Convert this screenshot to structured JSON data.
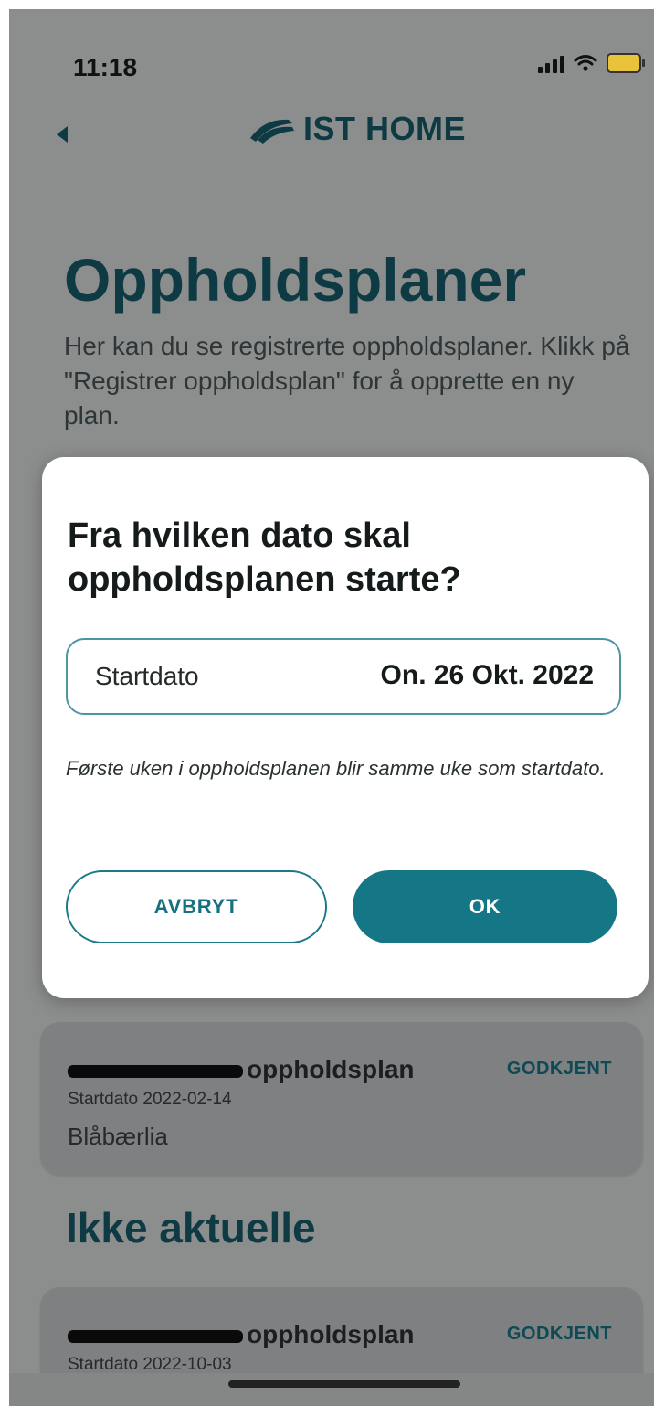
{
  "status_bar": {
    "time": "11:18",
    "signal_icon": "signal-icon",
    "wifi_icon": "wifi-icon",
    "battery_icon": "battery-charging-icon"
  },
  "header": {
    "back_icon": "back-arrow-icon",
    "logo_text": "IST HOME",
    "logo_icon": "ist-logo-icon"
  },
  "page": {
    "title": "Oppholdsplaner",
    "intro": "Her kan du se registrerte oppholdsplaner. Klikk på \"Registrer oppholdsplan\" for å opprette en ny plan."
  },
  "cards": [
    {
      "title_suffix": "oppholdsplan",
      "status": "GODKJENT",
      "date": "Startdato 2022-02-14",
      "place": "Blåbærlia"
    },
    {
      "title_suffix": "oppholdsplan",
      "status": "GODKJENT",
      "date": "Startdato 2022-10-03"
    }
  ],
  "sections": {
    "inactive": "Ikke aktuelle"
  },
  "modal": {
    "title": "Fra hvilken dato skal oppholdsplanen starte?",
    "field_label": "Startdato",
    "field_value": "On. 26 Okt. 2022",
    "note": "Første uken i oppholdsplanen blir samme uke som startdato.",
    "cancel_label": "AVBRYT",
    "ok_label": "OK"
  },
  "colors": {
    "primary": "#157686",
    "heading": "#0e3a44",
    "overlay": "#8c8d8d"
  }
}
